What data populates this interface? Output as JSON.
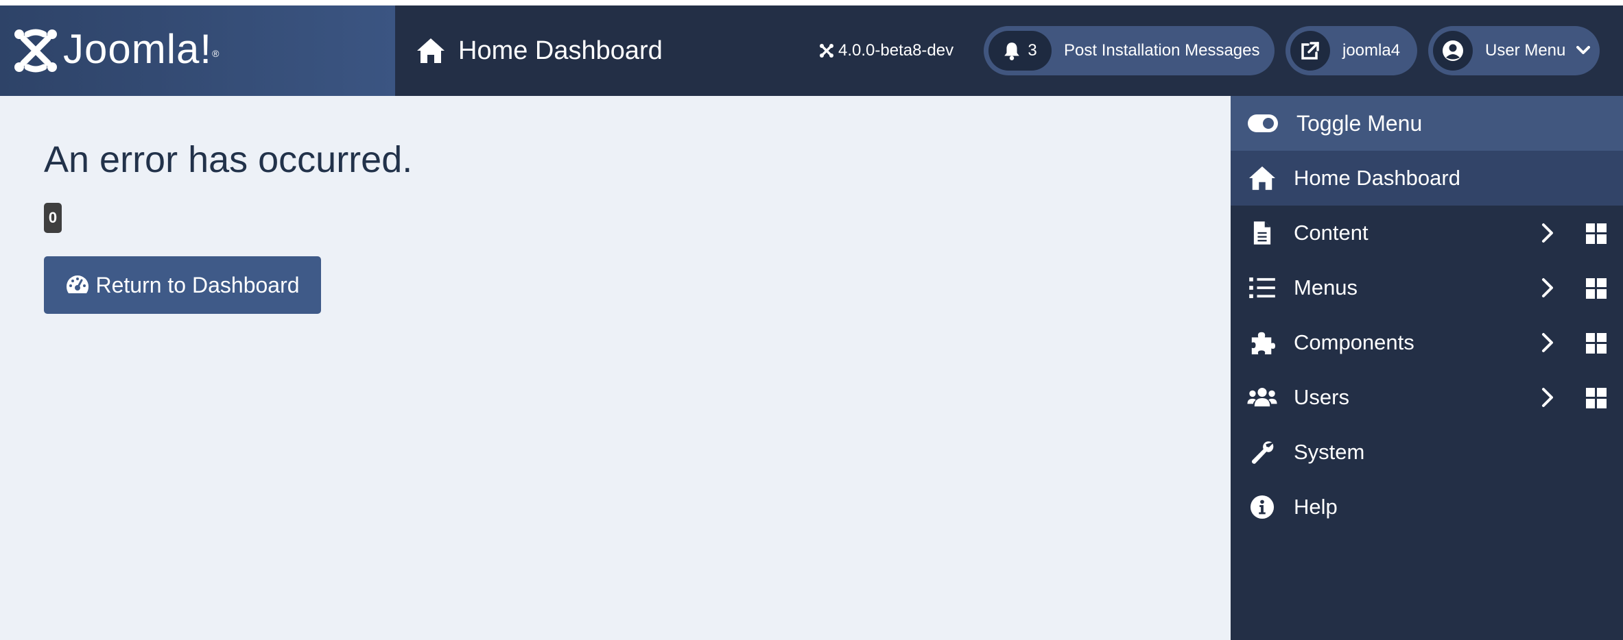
{
  "header": {
    "logo_text": "Joomla!",
    "page_title": "Home Dashboard",
    "version": "4.0.0-beta8-dev",
    "notifications": {
      "count": "3",
      "label": "Post Installation Messages"
    },
    "site_link": {
      "label": "joomla4"
    },
    "user_menu": {
      "label": "User Menu"
    }
  },
  "main": {
    "error_title": "An error has occurred.",
    "error_code": "0",
    "return_button": "Return to Dashboard"
  },
  "sidebar": {
    "toggle_label": "Toggle Menu",
    "items": [
      {
        "label": "Home Dashboard",
        "icon": "home-icon"
      },
      {
        "label": "Content",
        "icon": "file-icon"
      },
      {
        "label": "Menus",
        "icon": "list-icon"
      },
      {
        "label": "Components",
        "icon": "puzzle-icon"
      },
      {
        "label": "Users",
        "icon": "users-icon"
      },
      {
        "label": "System",
        "icon": "wrench-icon"
      },
      {
        "label": "Help",
        "icon": "info-icon"
      }
    ]
  },
  "colors": {
    "header_bg": "#232f46",
    "sidebar_bg": "#232f46",
    "accent": "#41577f",
    "main_bg": "#edf1f7",
    "title_text": "#22324a"
  }
}
